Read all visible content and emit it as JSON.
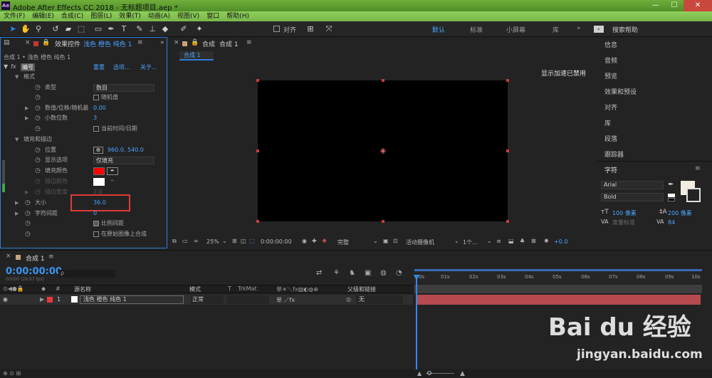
{
  "window": {
    "logo": "Ae",
    "title": "Adobe After Effects CC 2018 - 无标题项目.aep *",
    "min": "—",
    "max": "☐",
    "close": "✕"
  },
  "menu": [
    "文件(F)",
    "编辑(E)",
    "合成(C)",
    "图层(L)",
    "效果(T)",
    "动画(A)",
    "视图(V)",
    "窗口",
    "帮助(H)"
  ],
  "toolbar": {
    "snap_label": "对齐",
    "workspaces": [
      "默认",
      "标准",
      "小屏幕",
      "库"
    ],
    "workspace_more": "»",
    "search_placeholder": "搜索帮助"
  },
  "effects_panel": {
    "tab_label": "效果控件",
    "tab_layer": "浅色 橙色 纯色 1",
    "breadcrumb": "合成 1 • 浅色 橙色 纯色 1",
    "fx_name": "编号",
    "fx_links": [
      "重置",
      "选项...",
      "关于..."
    ],
    "rows": {
      "format": "格式",
      "type_label": "类型",
      "type_value": "数目",
      "random_label": "随机值",
      "numval_label": "数值/位移/随机最",
      "numval_value": "0.00",
      "decimals_label": "小数位数",
      "decimals_value": "3",
      "curtime_label": "当前时间/日期",
      "fill_stroke": "填充和描边",
      "position_label": "位置",
      "position_value": "960.0, 540.0",
      "display_label": "显示选项",
      "display_value": "仅填充",
      "fill_color_label": "填充颜色",
      "stroke_color_label": "描边颜色",
      "stroke_width_label": "描边宽度",
      "stroke_width_value": "2.0",
      "size_label": "大小",
      "size_value": "36.0",
      "tracking_label": "字符间距",
      "tracking_value": "0",
      "proportional_label": "比例间距",
      "composite_label": "在原始图像上合成"
    },
    "fill_color": "#ff0000",
    "highlight_color": "#e03b3b"
  },
  "comp_panel": {
    "tab_label": "合成",
    "tab_name": "合成 1",
    "sub_tab": "合成 1",
    "gpu_notice": "显示加速已禁用",
    "footer": {
      "zoom": "25%",
      "timecode": "0:00:00:00",
      "quality": "完整",
      "camera": "活动摄像机",
      "views": "1个...",
      "offset": "+0.0"
    }
  },
  "right_panel": {
    "items": [
      "信息",
      "音频",
      "预览",
      "效果和预设",
      "对齐",
      "库",
      "段落",
      "跟踪器"
    ],
    "char_title": "字符",
    "font": "Arial",
    "style": "Bold",
    "size": "100 像素",
    "leading": "200 像素",
    "kerning": "度量标准",
    "tracking": "84"
  },
  "timeline": {
    "tab_name": "合成 1",
    "timecode": "0:00:00:00",
    "frame_info": "00000 (29.97 fps)",
    "search_placeholder": "ρ",
    "col_source": "源名称",
    "col_mode": "模式",
    "col_t": "T",
    "col_trkmat": "TrkMat",
    "col_parent": "父级和链接",
    "ruler": [
      "0s",
      "01s",
      "02s",
      "03s",
      "04s",
      "05s",
      "06s",
      "07s",
      "08s",
      "09s",
      "10s"
    ],
    "layer": {
      "number": "1",
      "name": "浅色 橙色 纯色 1",
      "mode": "正常",
      "parent": "无",
      "label_color": "#e8383a",
      "bar_color": "#b54a4f"
    },
    "footer_left": "⊕ ⊙ ⊞"
  },
  "watermark": {
    "brand": "Bai du 经验",
    "url": "jingyan.baidu.com"
  }
}
